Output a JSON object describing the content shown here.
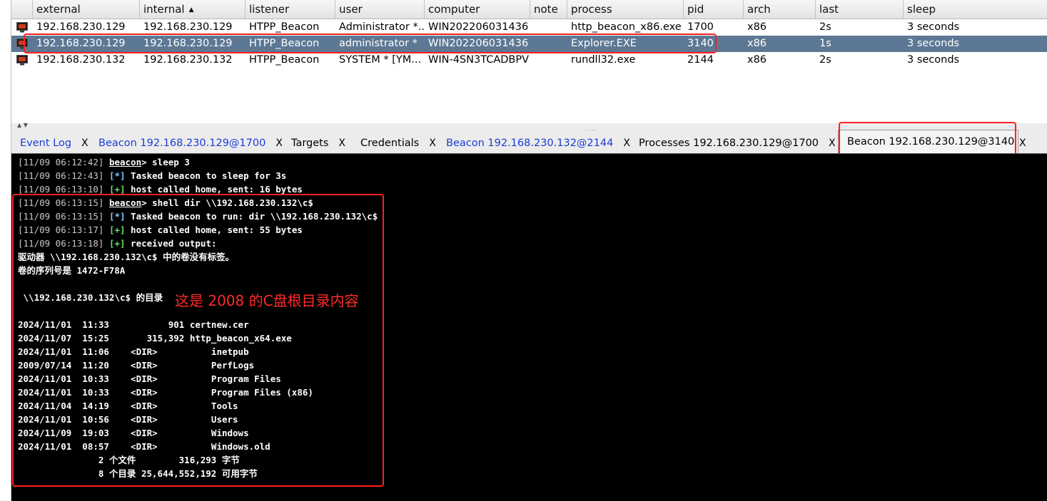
{
  "sessions_table": {
    "columns": [
      {
        "key": "external",
        "label": "external"
      },
      {
        "key": "internal",
        "label": "internal",
        "sorted": "ascending"
      },
      {
        "key": "listener",
        "label": "listener"
      },
      {
        "key": "user",
        "label": "user"
      },
      {
        "key": "computer",
        "label": "computer"
      },
      {
        "key": "note",
        "label": "note"
      },
      {
        "key": "process",
        "label": "process"
      },
      {
        "key": "pid",
        "label": "pid"
      },
      {
        "key": "arch",
        "label": "arch"
      },
      {
        "key": "last",
        "label": "last"
      },
      {
        "key": "sleep",
        "label": "sleep"
      }
    ],
    "sort_indicator": "▲",
    "rows": [
      {
        "external": "192.168.230.129",
        "internal": "192.168.230.129",
        "listener": "HTPP_Beacon",
        "user": "Administrator *...",
        "computer": "WIN202206031436",
        "note": "",
        "process": "http_beacon_x86.exe",
        "pid": "1700",
        "arch": "x86",
        "last": "2s",
        "sleep": "3 seconds",
        "selected": false
      },
      {
        "external": "192.168.230.129",
        "internal": "192.168.230.129",
        "listener": "HTPP_Beacon",
        "user": "administrator *",
        "computer": "WIN202206031436",
        "note": "",
        "process": "Explorer.EXE",
        "pid": "3140",
        "arch": "x86",
        "last": "1s",
        "sleep": "3 seconds",
        "selected": true
      },
      {
        "external": "192.168.230.132",
        "internal": "192.168.230.132",
        "listener": "HTPP_Beacon",
        "user": "SYSTEM * [YM...",
        "computer": "WIN-4SN3TCADBPV",
        "note": "",
        "process": "rundll32.exe",
        "pid": "2144",
        "arch": "x86",
        "last": "2s",
        "sleep": "3 seconds",
        "selected": false
      }
    ]
  },
  "splitter": {
    "arrows_up": "▲",
    "arrows_down": "▼",
    "grip": "....."
  },
  "tabs": [
    {
      "label": "Event Log",
      "close": "X",
      "blue": true,
      "active": false
    },
    {
      "label": "Beacon 192.168.230.129@1700",
      "close": "X",
      "blue": true,
      "active": false
    },
    {
      "label": "Targets",
      "close": "X",
      "blue": false,
      "active": false
    },
    {
      "label": "Credentials",
      "close": "X",
      "blue": false,
      "active": false
    },
    {
      "label": "Beacon 192.168.230.132@2144",
      "close": "X",
      "blue": true,
      "active": false
    },
    {
      "label": "Processes 192.168.230.129@1700",
      "close": "X",
      "blue": false,
      "active": false
    },
    {
      "label": "Beacon 192.168.230.129@3140",
      "close": "X",
      "blue": false,
      "active": true
    }
  ],
  "console": {
    "lines": [
      {
        "ts": "[11/09 06:12:42]",
        "prompt": "beacon",
        "text": "> sleep 3"
      },
      {
        "ts": "[11/09 06:12:43]",
        "tag": "[*]",
        "tag_type": "info",
        "text": " Tasked beacon to sleep for 3s"
      },
      {
        "ts": "[11/09 06:13:10]",
        "tag": "[+]",
        "tag_type": "ok",
        "text": " host called home, sent: 16 bytes"
      },
      {
        "ts": "[11/09 06:13:15]",
        "prompt": "beacon",
        "text": "> shell dir \\\\192.168.230.132\\c$"
      },
      {
        "ts": "[11/09 06:13:15]",
        "tag": "[*]",
        "tag_type": "info",
        "text": " Tasked beacon to run: dir \\\\192.168.230.132\\c$"
      },
      {
        "ts": "[11/09 06:13:17]",
        "tag": "[+]",
        "tag_type": "ok",
        "text": " host called home, sent: 55 bytes"
      },
      {
        "ts": "[11/09 06:13:18]",
        "tag": "[+]",
        "tag_type": "ok",
        "text": " received output:"
      },
      {
        "text": "驱动器 \\\\192.168.230.132\\c$ 中的卷没有标签。"
      },
      {
        "text": "卷的序列号是 1472-F78A"
      },
      {
        "text": ""
      },
      {
        "text": " \\\\192.168.230.132\\c$ 的目录"
      },
      {
        "text": ""
      },
      {
        "text": "2024/11/01  11:33           901 certnew.cer"
      },
      {
        "text": "2024/11/07  15:25       315,392 http_beacon_x64.exe"
      },
      {
        "text": "2024/11/01  11:06    <DIR>          inetpub"
      },
      {
        "text": "2009/07/14  11:20    <DIR>          PerfLogs"
      },
      {
        "text": "2024/11/01  10:33    <DIR>          Program Files"
      },
      {
        "text": "2024/11/01  10:33    <DIR>          Program Files (x86)"
      },
      {
        "text": "2024/11/04  14:19    <DIR>          Tools"
      },
      {
        "text": "2024/11/01  10:56    <DIR>          Users"
      },
      {
        "text": "2024/11/09  19:03    <DIR>          Windows"
      },
      {
        "text": "2024/11/01  08:57    <DIR>          Windows.old"
      },
      {
        "text": "               2 个文件        316,293 字节"
      },
      {
        "text": "               8 个目录 25,644,552,192 可用字节"
      }
    ],
    "annotation": "这是 2008 的C盘根目录内容"
  },
  "colors": {
    "selected_row": "#5d7894",
    "highlight": "#ff2020",
    "tab_blue": "#1a3cd6",
    "ok_green": "#5ee05e",
    "info_blue": "#7ec8ff"
  }
}
